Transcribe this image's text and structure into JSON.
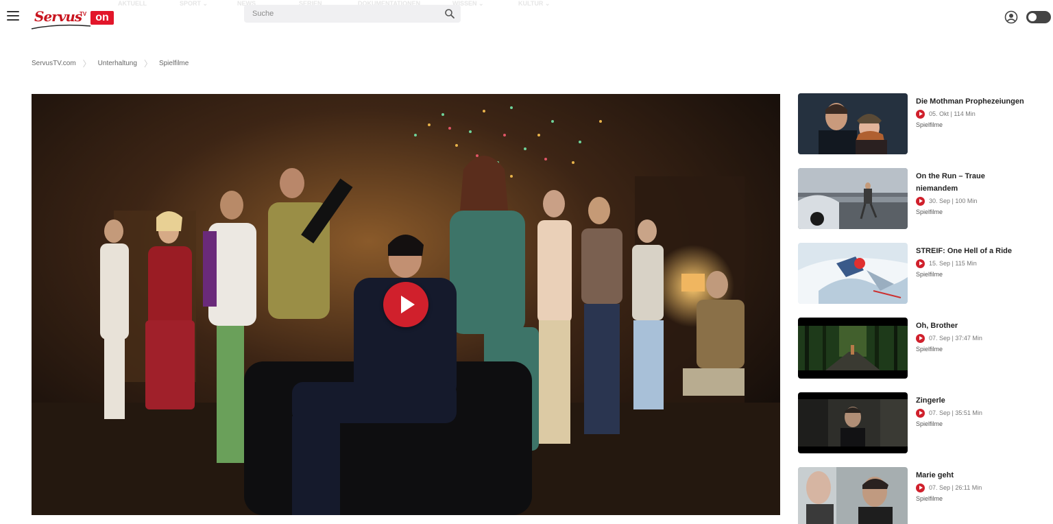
{
  "header": {
    "logo_text": "Servus",
    "logo_tv": "TV",
    "logo_on": "on",
    "nav_ghost": [
      "AKTUELL",
      "SPORT ⌄",
      "NEWS",
      "SERIEN",
      "DOKUMENTATIONEN",
      "WISSEN ⌄",
      "KULTUR ⌄"
    ],
    "search": {
      "placeholder": "Suche"
    }
  },
  "breadcrumb": [
    "ServusTV.com",
    "Unterhaltung",
    "Spielfilme"
  ],
  "colors": {
    "accent": "#d0202c",
    "brand": "#e2162a"
  },
  "sidebar": {
    "items": [
      {
        "title": "Die Mothman Prophezeiungen",
        "date": "05. Okt",
        "duration": "114 Min",
        "meta": "05. Okt | 114 Min",
        "genre": "Spielfilme"
      },
      {
        "title": "On the Run – Traue niemandem",
        "date": "30. Sep",
        "duration": "100 Min",
        "meta": "30. Sep | 100 Min",
        "genre": "Spielfilme"
      },
      {
        "title": "STREIF: One Hell of a Ride",
        "date": "15. Sep",
        "duration": "115 Min",
        "meta": "15. Sep | 115 Min",
        "genre": "Spielfilme"
      },
      {
        "title": "Oh, Brother",
        "date": "07. Sep",
        "duration": "37:47 Min",
        "meta": "07. Sep | 37:47 Min",
        "genre": "Spielfilme"
      },
      {
        "title": "Zingerle",
        "date": "07. Sep",
        "duration": "35:51 Min",
        "meta": "07. Sep | 35:51 Min",
        "genre": "Spielfilme"
      },
      {
        "title": "Marie geht",
        "date": "07. Sep",
        "duration": "26:11 Min",
        "meta": "07. Sep | 26:11 Min",
        "genre": "Spielfilme"
      }
    ]
  }
}
